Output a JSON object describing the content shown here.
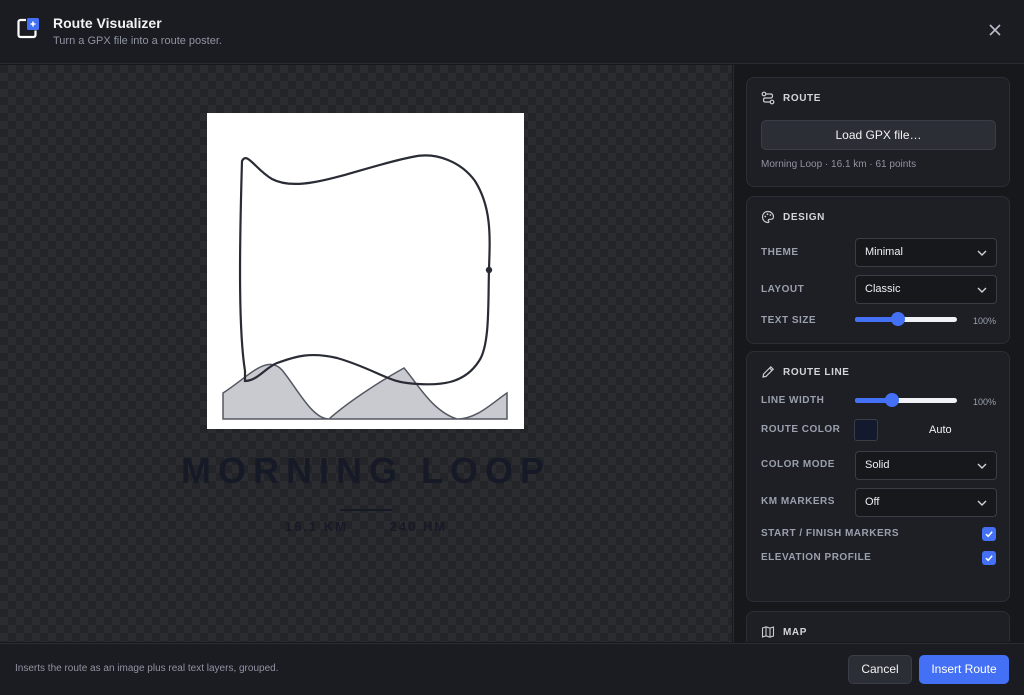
{
  "header": {
    "title": "Route Visualizer",
    "subtitle": "Turn a GPX file into a route poster.",
    "close_icon": "close-icon",
    "app_icon": "route-visualizer-icon"
  },
  "poster": {
    "title": "MORNING LOOP",
    "stats": [
      "16.1 KM",
      "240 HM"
    ]
  },
  "route_panel": {
    "heading": "ROUTE",
    "icon": "route-icon",
    "load_button": "Load GPX file…",
    "info": "Morning Loop · 16.1 km · 61 points"
  },
  "design_panel": {
    "heading": "DESIGN",
    "icon": "palette-icon",
    "theme_label": "THEME",
    "theme_value": "Minimal",
    "layout_label": "LAYOUT",
    "layout_value": "Classic",
    "text_size_label": "TEXT SIZE",
    "text_size_value": "100%",
    "text_size_level": 0.42
  },
  "route_line_panel": {
    "heading": "ROUTE LINE",
    "icon": "pencil-icon",
    "line_width_label": "LINE WIDTH",
    "line_width_value": "100%",
    "line_width_level": 0.36,
    "route_color_label": "ROUTE COLOR",
    "route_color_hex": "#141a2e",
    "route_color_value": "Auto",
    "color_mode_label": "COLOR MODE",
    "color_mode_value": "Solid",
    "km_markers_label": "KM MARKERS",
    "km_markers_value": "Off",
    "start_finish_label": "START / FINISH MARKERS",
    "start_finish_checked": true,
    "elevation_label": "ELEVATION PROFILE",
    "elevation_checked": true
  },
  "map_panel": {
    "heading": "MAP",
    "icon": "map-icon"
  },
  "footer": {
    "note": "Inserts the route as an image plus real text layers, grouped.",
    "cancel_label": "Cancel",
    "insert_label": "Insert Route"
  },
  "colors": {
    "accent": "#4470f5",
    "background": "#17181c",
    "poster_ink": "#161a27"
  }
}
